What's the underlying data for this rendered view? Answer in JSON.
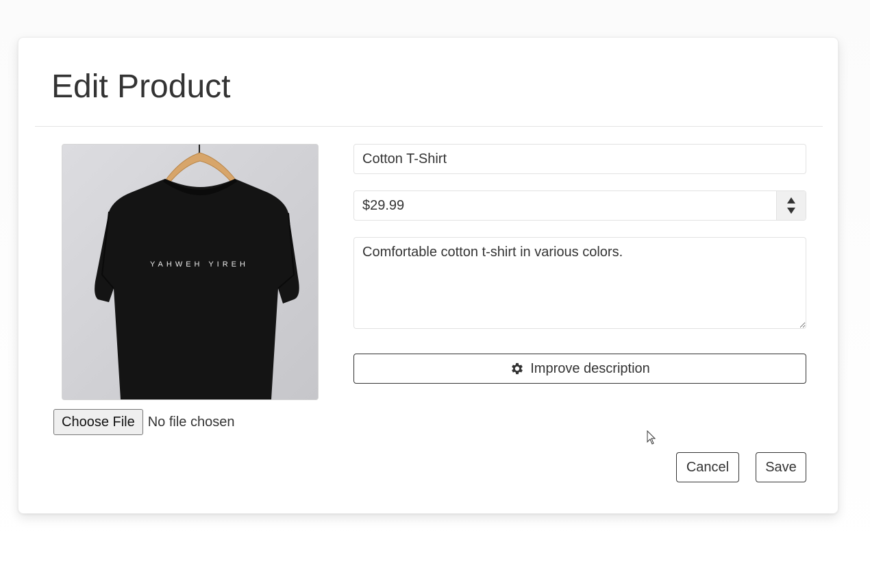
{
  "header": {
    "title": "Edit Product"
  },
  "image_panel": {
    "image_icon": "tshirt-photo",
    "shirt_print_text": "YAHWEH YIREH",
    "choose_file_label": "Choose File",
    "file_status": "No file chosen"
  },
  "form": {
    "name_value": "Cotton T-Shirt",
    "price_value": "$29.99",
    "description_value": "Comfortable cotton t-shirt in various colors.",
    "improve_label": "Improve description",
    "improve_icon": "gear-icon"
  },
  "actions": {
    "cancel_label": "Cancel",
    "save_label": "Save"
  },
  "colors": {
    "text": "#333333",
    "border": "#e2e2e2",
    "shirt": "#111111",
    "background": "#ffffff"
  }
}
